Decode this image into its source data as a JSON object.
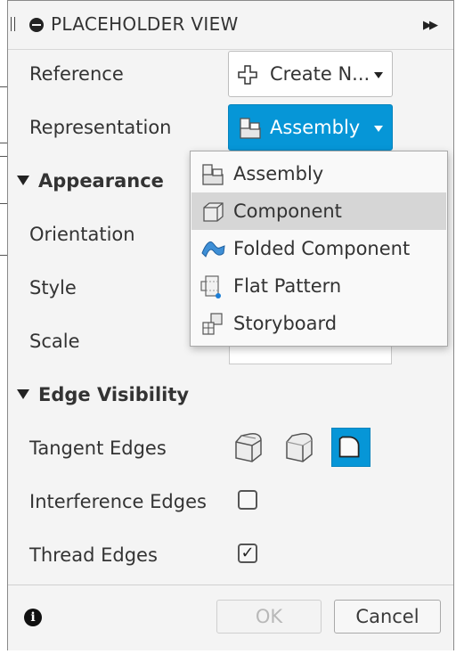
{
  "window": {
    "title": "PLACEHOLDER VIEW"
  },
  "fields": {
    "reference_label": "Reference",
    "reference_value": "Create N...",
    "representation_label": "Representation",
    "representation_value": "Assembly"
  },
  "appearance": {
    "section_label": "Appearance",
    "orientation_label": "Orientation",
    "style_label": "Style",
    "scale_label": "Scale"
  },
  "edge_visibility": {
    "section_label": "Edge Visibility",
    "tangent_label": "Tangent Edges",
    "interference_label": "Interference Edges",
    "interference_checked": false,
    "thread_label": "Thread Edges",
    "thread_checked": true,
    "thread_check_glyph": "✓"
  },
  "representation_menu": {
    "items": [
      {
        "label": "Assembly",
        "icon": "assembly-icon"
      },
      {
        "label": "Component",
        "icon": "component-icon",
        "highlighted": true
      },
      {
        "label": "Folded Component",
        "icon": "folded-component-icon"
      },
      {
        "label": "Flat Pattern",
        "icon": "flat-pattern-icon"
      },
      {
        "label": "Storyboard",
        "icon": "storyboard-icon"
      }
    ]
  },
  "footer": {
    "info_glyph": "i",
    "ok_label": "OK",
    "cancel_label": "Cancel"
  },
  "colors": {
    "accent": "#0696d7",
    "dialog_bg": "#f4f4f4",
    "menu_highlight": "#d6d6d6"
  }
}
